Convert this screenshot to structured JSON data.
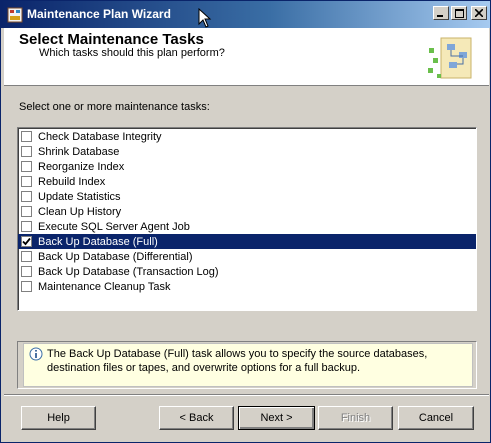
{
  "window": {
    "title": "Maintenance Plan Wizard"
  },
  "header": {
    "title": "Select Maintenance Tasks",
    "subtitle": "Which tasks should this plan perform?"
  },
  "tasks": {
    "prompt": "Select one or more maintenance tasks:",
    "items": [
      {
        "label": "Check Database Integrity",
        "checked": false,
        "selected": false
      },
      {
        "label": "Shrink Database",
        "checked": false,
        "selected": false
      },
      {
        "label": "Reorganize Index",
        "checked": false,
        "selected": false
      },
      {
        "label": "Rebuild Index",
        "checked": false,
        "selected": false
      },
      {
        "label": "Update Statistics",
        "checked": false,
        "selected": false
      },
      {
        "label": "Clean Up History",
        "checked": false,
        "selected": false
      },
      {
        "label": "Execute SQL Server Agent Job",
        "checked": false,
        "selected": false
      },
      {
        "label": "Back Up Database (Full)",
        "checked": true,
        "selected": true
      },
      {
        "label": "Back Up Database (Differential)",
        "checked": false,
        "selected": false
      },
      {
        "label": "Back Up Database (Transaction Log)",
        "checked": false,
        "selected": false
      },
      {
        "label": "Maintenance Cleanup Task",
        "checked": false,
        "selected": false
      }
    ]
  },
  "info": {
    "text": "The Back Up Database (Full) task allows you to specify the source databases, destination files or tapes, and overwrite options for a full backup."
  },
  "buttons": {
    "help": "Help",
    "back": "< Back",
    "next": "Next >",
    "finish": "Finish",
    "cancel": "Cancel"
  },
  "colors": {
    "title_bar": "#0a246a",
    "selection": "#0a246a",
    "info_background": "#ffffe1",
    "dialog_background": "#d4d0c8"
  }
}
